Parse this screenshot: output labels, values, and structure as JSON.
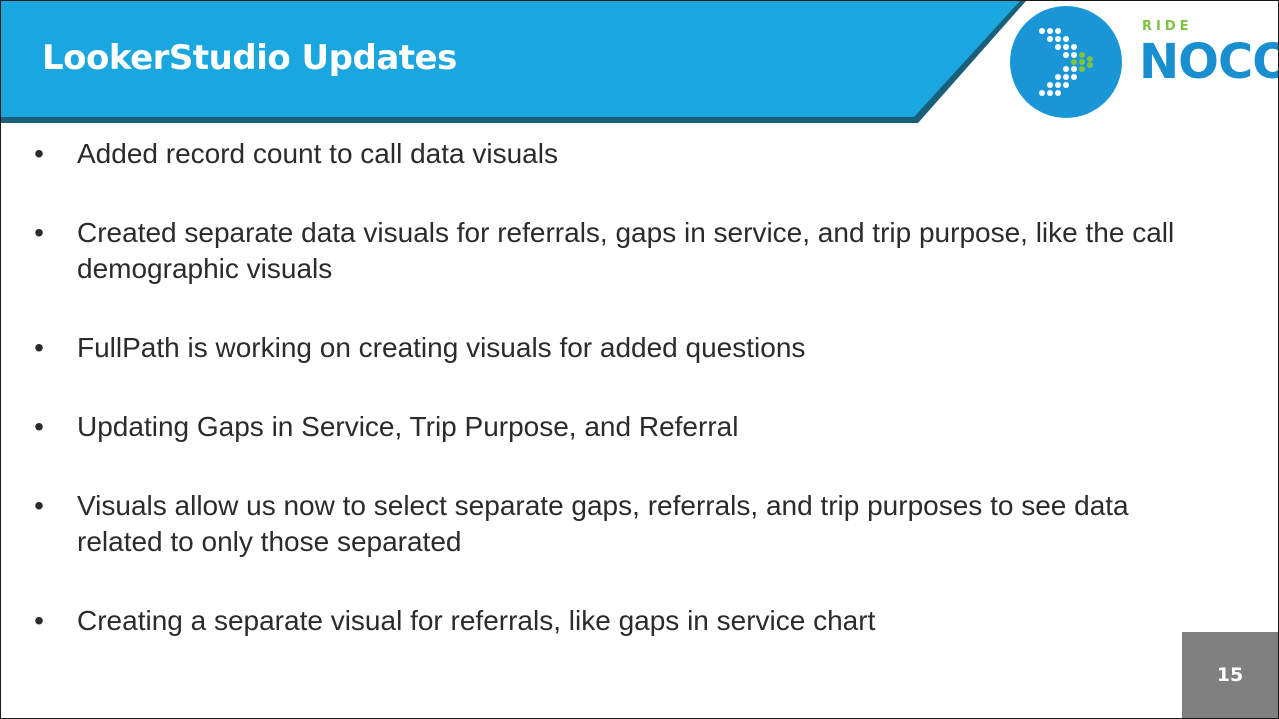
{
  "slide": {
    "title": "LookerStudio Updates",
    "logo": {
      "ride": "RIDE",
      "noco": "NOCO"
    },
    "bullets": [
      "Added record count to call data visuals",
      "Created separate data visuals for referrals, gaps in service, and trip purpose, like the call demographic visuals",
      "FullPath is working on creating visuals for added questions",
      "Updating Gaps in Service, Trip Purpose, and Referral",
      "Visuals allow us now to select separate gaps, referrals, and trip purposes to see data related to only those separated",
      "Creating a separate visual for referrals, like gaps in service chart"
    ],
    "page_number": "15"
  },
  "colors": {
    "header_blue": "#1aa7e0",
    "header_dark": "#1a5f7a",
    "logo_circle": "#1a96d6",
    "logo_green": "#7ec242",
    "noco_text": "#1a8fd0",
    "page_box": "#808080",
    "text": "#2b2b2b"
  }
}
